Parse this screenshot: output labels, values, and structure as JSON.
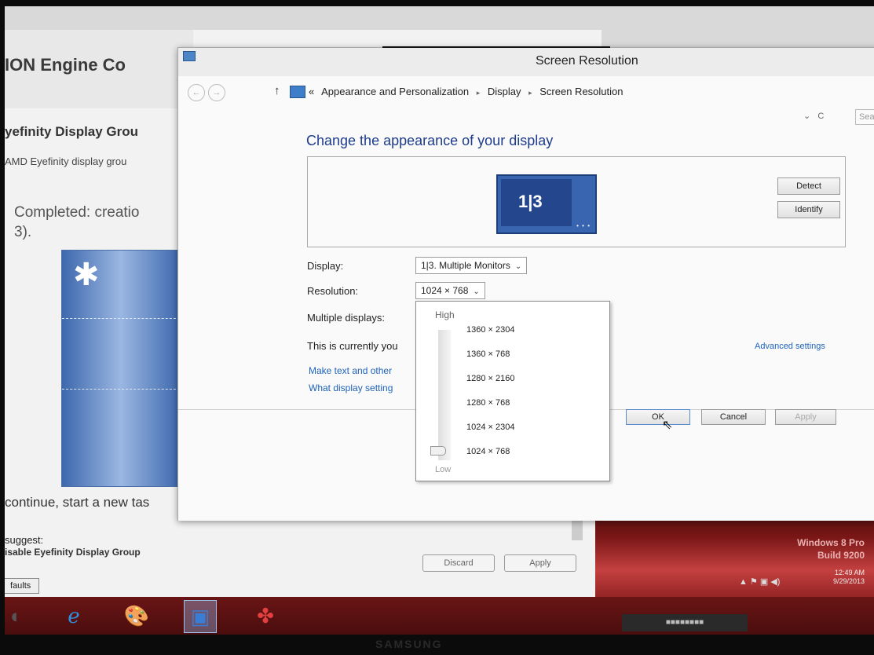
{
  "amd_window": {
    "title": "ION Engine Co",
    "subtitle": "yefinity Display Grou",
    "description": "AMD Eyefinity display grou",
    "completed": "Completed: creatio",
    "completed_cont": "3).",
    "continue": "continue, start a new tas",
    "suggest": "suggest:",
    "disable": "isable Eyefinity Display Group",
    "defaults_btn": "faults",
    "discard_btn": "Discard",
    "apply_btn": "Apply"
  },
  "dialog": {
    "title": "Screen Resolution",
    "breadcrumb": [
      "Appearance and Personalization",
      "Display",
      "Screen Resolution"
    ],
    "breadcrumb_prefix": "«",
    "search_placeholder": "Sear",
    "heading": "Change the appearance of your display",
    "monitor_label": "1|3",
    "detect_btn": "Detect",
    "identify_btn": "Identify",
    "display_label": "Display:",
    "display_value": "1|3. Multiple Monitors",
    "resolution_label": "Resolution:",
    "resolution_value": "1024 × 768",
    "multiple_label": "Multiple displays:",
    "current_text": "This is currently you",
    "advanced_link": "Advanced settings",
    "link1": "Make text and other",
    "link2": "What display setting",
    "ok_btn": "OK",
    "cancel_btn": "Cancel",
    "apply_btn": "Apply"
  },
  "resolution_dropdown": {
    "high_label": "High",
    "low_label": "Low",
    "options": [
      "1360 × 2304",
      "1360 × 768",
      "1280 × 2160",
      "1280 × 768",
      "1024 × 2304",
      "1024 × 768"
    ],
    "selected": "1024 × 768",
    "slider_level": 0
  },
  "desktop": {
    "edition": "Windows 8 Pro",
    "build": "Build 9200",
    "time": "12:49 AM",
    "date": "9/29/2013"
  },
  "taskbar": {
    "items": [
      "internet-explorer-icon",
      "paint-icon",
      "screen-resolution-icon",
      "amd-catalyst-icon"
    ]
  },
  "bezel": {
    "brand": "SAMSUNG"
  }
}
